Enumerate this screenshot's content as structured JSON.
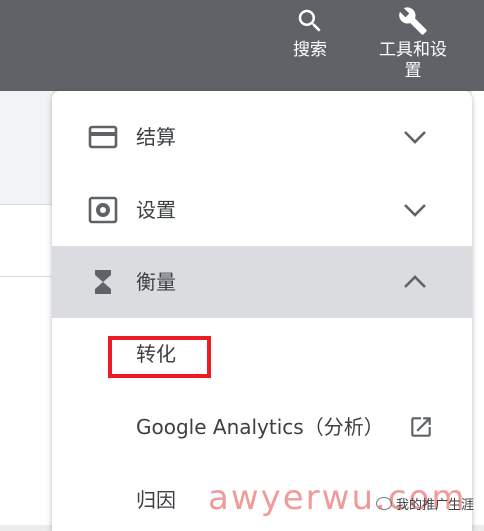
{
  "topbar": {
    "search_label": "搜索",
    "tools_label_line1": "工具和设",
    "tools_label_line2": "置"
  },
  "menu": {
    "items": [
      {
        "label": "结算",
        "icon": "credit-card-icon",
        "state": "collapsed"
      },
      {
        "label": "设置",
        "icon": "settings-gear-icon",
        "state": "collapsed"
      },
      {
        "label": "衡量",
        "icon": "hourglass-icon",
        "state": "expanded"
      }
    ],
    "submenu": {
      "conversions": "转化",
      "google_analytics": "Google Analytics（分析）",
      "attribution": "归因"
    }
  },
  "watermark": {
    "text": "awyerwu.com"
  },
  "wechat": {
    "text": "我的推广生涯"
  },
  "colors": {
    "topbar": "#5f6368",
    "active_row": "#dadce0",
    "highlight_box": "#ea1c24"
  }
}
